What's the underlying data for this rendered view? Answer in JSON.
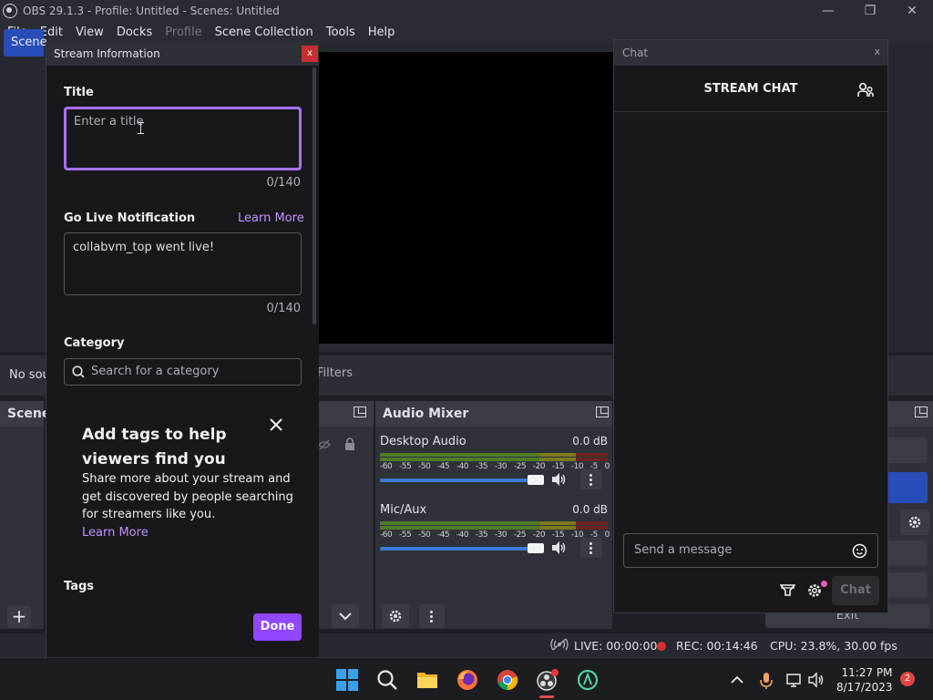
{
  "window": {
    "title": "OBS 29.1.3 - Profile: Untitled - Scenes: Untitled"
  },
  "menu": [
    "File",
    "Edit",
    "View",
    "Docks",
    "Profile",
    "Scene Collection",
    "Tools",
    "Help"
  ],
  "sources_bar": {
    "no_source": "No source selected",
    "filters": "Filters"
  },
  "scenes": {
    "header": "Scenes",
    "item": "Scene"
  },
  "audio_mixer": {
    "header": "Audio Mixer",
    "ticks": [
      "-60",
      "-55",
      "-50",
      "-45",
      "-40",
      "-35",
      "-30",
      "-25",
      "-20",
      "-15",
      "-10",
      "-5",
      "0"
    ],
    "channels": [
      {
        "name": "Desktop Audio",
        "db": "0.0 dB",
        "volume": 0.92
      },
      {
        "name": "Mic/Aux",
        "db": "0.0 dB",
        "volume": 0.92
      }
    ]
  },
  "controls": {
    "exit": "Exit"
  },
  "status": {
    "live": "LIVE: 00:00:00",
    "rec": "REC: 00:14:46",
    "cpu": "CPU: 23.8%, 30.00 fps"
  },
  "stream_info": {
    "window_title": "Stream Information",
    "close": "x",
    "title_label": "Title",
    "title_placeholder": "Enter a title",
    "title_count": "0/140",
    "notify_label": "Go Live Notification",
    "learn_more": "Learn More",
    "notify_value": "collabvm_top went live!",
    "notify_count": "0/140",
    "category_label": "Category",
    "category_placeholder": "Search for a category",
    "tags_promo_title": "Add tags to help viewers find you",
    "tags_promo_body": "Share more about your stream and get discovered by people searching for streamers like you.",
    "tags_promo_link": "Learn More",
    "tags_label": "Tags",
    "done": "Done"
  },
  "chat": {
    "window_title": "Chat",
    "close": "x",
    "header": "STREAM CHAT",
    "placeholder": "Send a message",
    "send": "Chat"
  },
  "taskbar": {
    "time": "11:27 PM",
    "date": "8/17/2023",
    "notifications": "2"
  },
  "colors": {
    "twitch_purple": "#9147ff",
    "focus_border": "#a970ff",
    "obs_blue": "#284cb8",
    "rec_red": "#d5322f"
  }
}
